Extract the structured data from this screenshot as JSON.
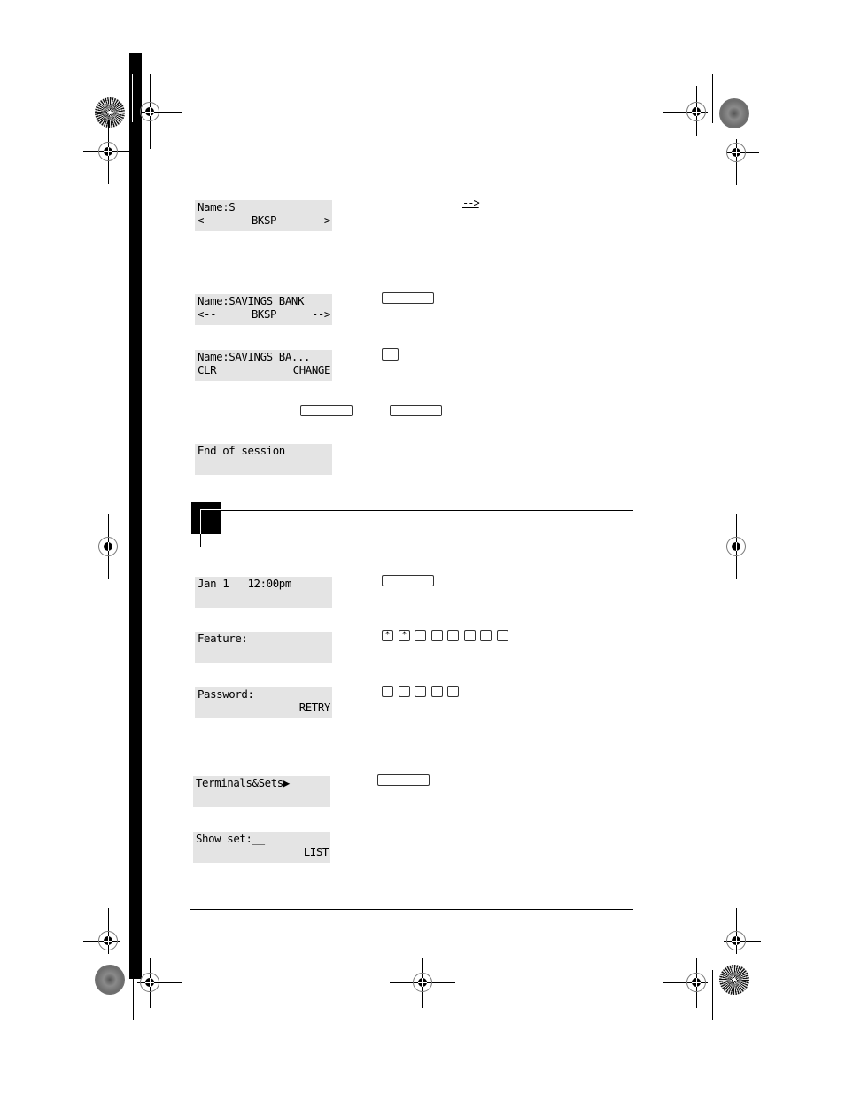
{
  "document": {
    "section1": {
      "steps": [
        {
          "display": {
            "line1": "Name:S_",
            "line2_left": "<--",
            "line2_center": "BKSP",
            "line2_right": "-->"
          },
          "instruction_arrow": "-->"
        },
        {
          "display": {
            "line1": "Name:SAVINGS BANK",
            "line2_left": "<--",
            "line2_center": "BKSP",
            "line2_right": "-->"
          },
          "key": "blank-display-key"
        },
        {
          "display": {
            "line1": "Name:SAVINGS BA...",
            "line2_left": "CLR",
            "line2_right": "CHANGE"
          },
          "key": "blank-small-key"
        },
        {
          "keys": [
            "blank-display-key",
            "blank-display-key"
          ]
        },
        {
          "display": {
            "line1": "End of session",
            "line2": ""
          }
        }
      ]
    },
    "section2": {
      "steps": [
        {
          "display": {
            "line1": "Jan 1   12:00pm",
            "line2": ""
          },
          "key": "blank-display-key"
        },
        {
          "display": {
            "line1": "Feature:",
            "line2": ""
          },
          "dial_keys": [
            "*",
            "*",
            "",
            "",
            "",
            "",
            "",
            ""
          ]
        },
        {
          "display": {
            "line1": "Password:",
            "line2_right": "RETRY"
          },
          "dial_keys": [
            "",
            "",
            "",
            "",
            ""
          ]
        },
        {
          "display": {
            "line1": "Terminals&Sets▶",
            "line2": ""
          },
          "key": "blank-display-key"
        },
        {
          "display": {
            "line1": "Show set:__",
            "line2_right": "LIST"
          }
        }
      ]
    }
  }
}
